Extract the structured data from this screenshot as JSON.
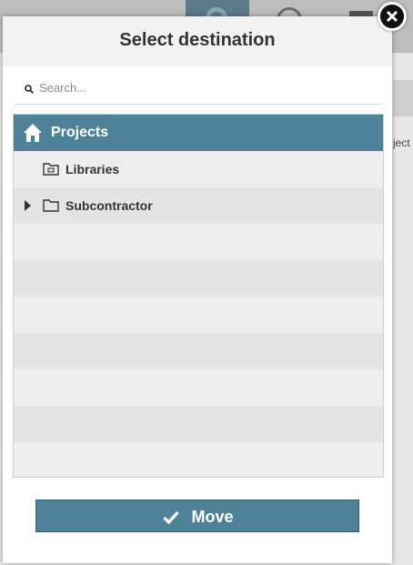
{
  "dialog": {
    "title": "Select destination",
    "close_icon": "close-icon"
  },
  "search": {
    "placeholder": "Search...",
    "value": "",
    "icon": "search-icon"
  },
  "tree": {
    "root": {
      "label": "Projects",
      "icon": "home-icon"
    },
    "items": [
      {
        "label": "Libraries",
        "icon": "library-folder-icon",
        "expandable": false
      },
      {
        "label": "Subcontractor",
        "icon": "folder-icon",
        "expandable": true
      }
    ]
  },
  "footer": {
    "move_label": "Move",
    "move_icon": "checkmark-icon"
  },
  "colors": {
    "accent": "#4f8199",
    "header_bg": "#f2f2f2",
    "tree_bg": "#eeeeee",
    "tree_alt_row": "#e4e4e4"
  }
}
